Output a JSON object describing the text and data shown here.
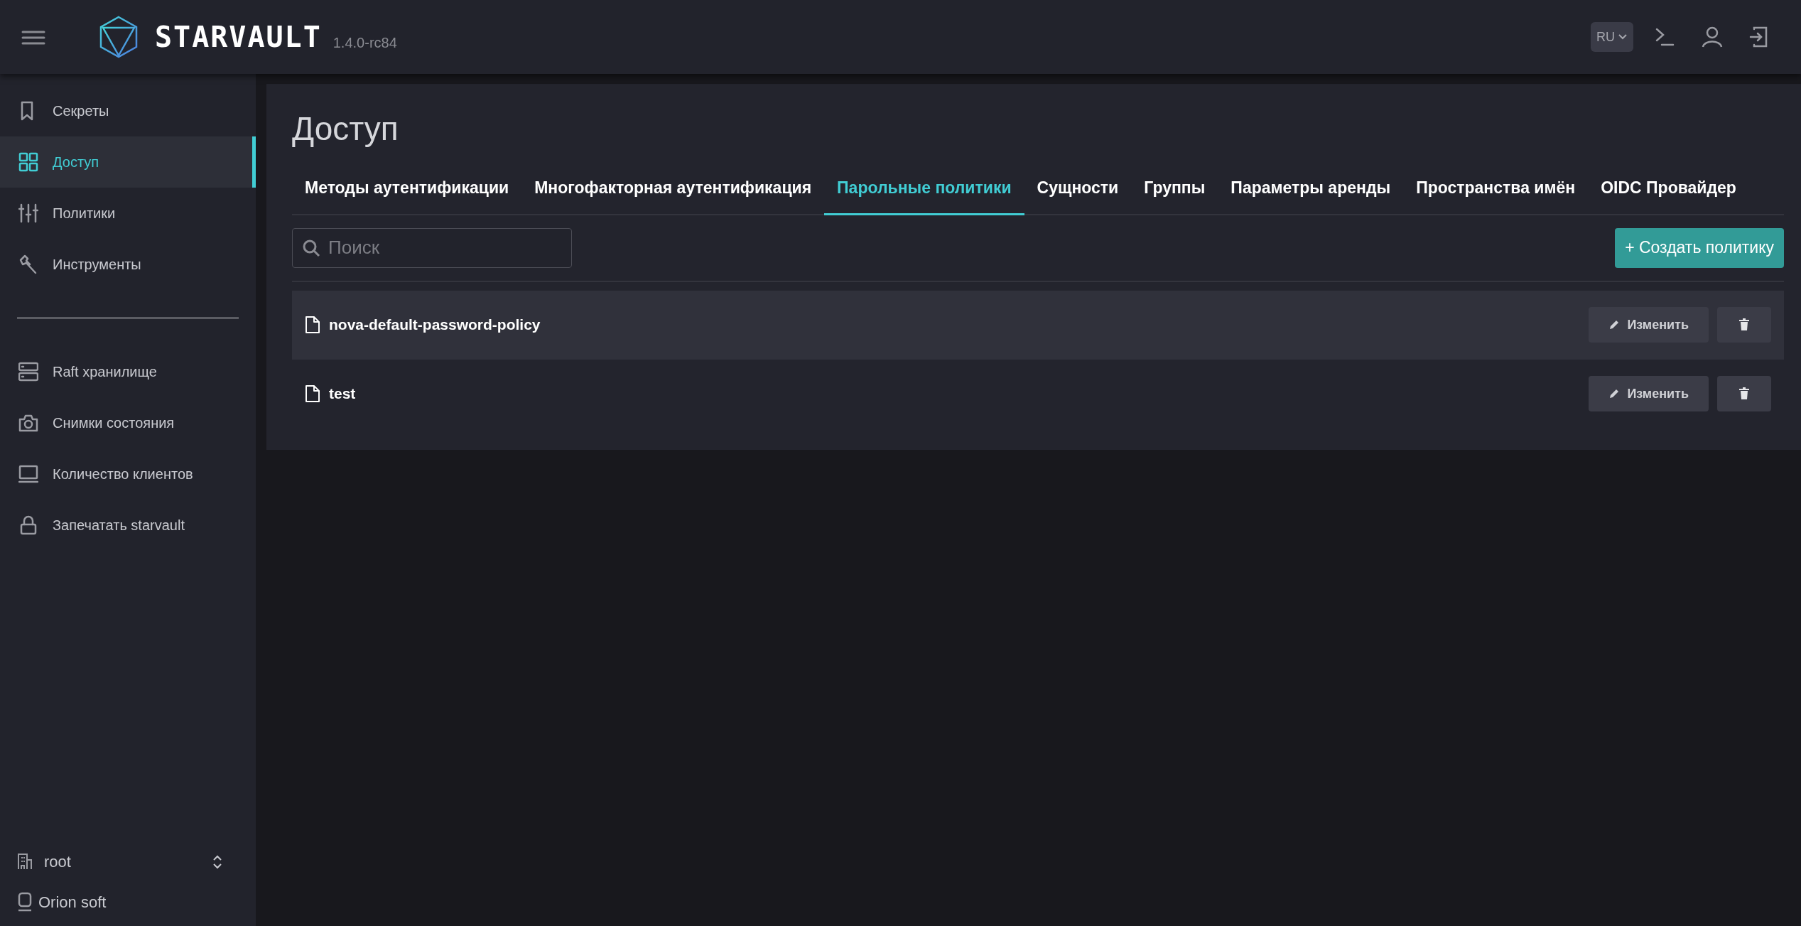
{
  "header": {
    "logo": "STARVAULT",
    "version": "1.4.0-rc84",
    "language": "RU"
  },
  "sidebar": {
    "items": [
      {
        "label": "Секреты",
        "kind": "bookmark",
        "selected": false
      },
      {
        "label": "Доступ",
        "kind": "grid",
        "selected": true
      },
      {
        "label": "Политики",
        "kind": "sliders",
        "selected": false
      },
      {
        "label": "Инструменты",
        "kind": "wrench",
        "selected": false
      }
    ],
    "system_items": [
      {
        "label": "Raft хранилище",
        "kind": "server",
        "selected": false
      },
      {
        "label": "Снимки состояния",
        "kind": "camera",
        "selected": false
      },
      {
        "label": "Количество клиентов",
        "kind": "laptop",
        "selected": false
      },
      {
        "label": "Запечатать starvault",
        "kind": "lock",
        "selected": false
      }
    ],
    "namespace": "root",
    "vendor": "Orion soft"
  },
  "page": {
    "title": "Доступ",
    "tabs": [
      {
        "label": "Методы аутентификации",
        "selected": false
      },
      {
        "label": "Многофакторная аутентификация",
        "selected": false
      },
      {
        "label": "Парольные политики",
        "selected": true
      },
      {
        "label": "Сущности",
        "selected": false
      },
      {
        "label": "Группы",
        "selected": false
      },
      {
        "label": "Параметры аренды",
        "selected": false
      },
      {
        "label": "Пространства имён",
        "selected": false
      },
      {
        "label": "OIDC Провайдер",
        "selected": false
      }
    ],
    "search": {
      "placeholder": "Поиск"
    },
    "create_button": "+ Создать политику",
    "rows": [
      {
        "name": "nova-default-password-policy",
        "edit": "Изменить",
        "hovered": true
      },
      {
        "name": "test",
        "edit": "Изменить",
        "hovered": false
      }
    ]
  }
}
